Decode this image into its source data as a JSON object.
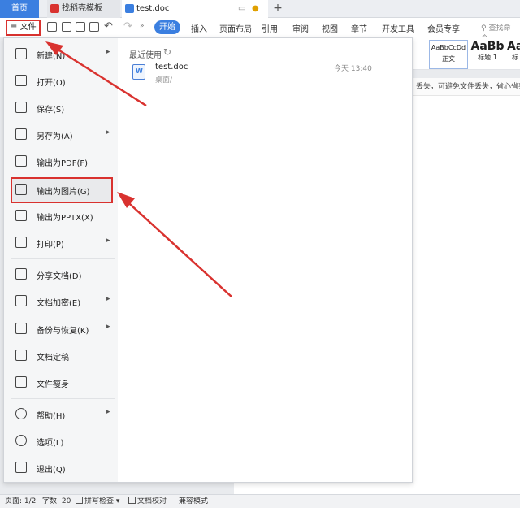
{
  "tabs": {
    "home": "首页",
    "template": "找稻壳模板",
    "doc": "test.doc"
  },
  "toolbar": {
    "file": "文件",
    "start": "开始",
    "items": [
      "插入",
      "页面布局",
      "引用",
      "审阅",
      "视图",
      "章节",
      "开发工具",
      "会员专享"
    ],
    "search": "查找命令、"
  },
  "styles": {
    "normal_sample": "AaBbCcDd",
    "normal_label": "正文",
    "h1_sample": "AaBb",
    "h1_label": "标题 1",
    "h2_sample": "Aa",
    "h2_label": "标"
  },
  "notice": "丢失，可避免文件丢失，省心省事",
  "menu": {
    "items": [
      {
        "label": "新建(N)",
        "icon": "new-file-icon",
        "arrow": "▸"
      },
      {
        "label": "打开(O)",
        "icon": "open-folder-icon",
        "arrow": ""
      },
      {
        "label": "保存(S)",
        "icon": "save-icon",
        "arrow": ""
      },
      {
        "label": "另存为(A)",
        "icon": "save-as-icon",
        "arrow": "▸"
      },
      {
        "label": "输出为PDF(F)",
        "icon": "pdf-icon",
        "arrow": ""
      },
      {
        "label": "输出为图片(G)",
        "icon": "image-icon",
        "arrow": ""
      },
      {
        "label": "输出为PPTX(X)",
        "icon": "pptx-icon",
        "arrow": ""
      },
      {
        "label": "打印(P)",
        "icon": "print-icon",
        "arrow": "▸"
      },
      {
        "label": "分享文档(D)",
        "icon": "share-icon",
        "arrow": ""
      },
      {
        "label": "文档加密(E)",
        "icon": "lock-icon",
        "arrow": "▸"
      },
      {
        "label": "备份与恢复(K)",
        "icon": "backup-icon",
        "arrow": "▸"
      },
      {
        "label": "文档定稿",
        "icon": "finalize-icon",
        "arrow": ""
      },
      {
        "label": "文件瘦身",
        "icon": "slim-icon",
        "arrow": ""
      },
      {
        "label": "帮助(H)",
        "icon": "help-icon",
        "arrow": "▸"
      },
      {
        "label": "选项(L)",
        "icon": "gear-icon",
        "arrow": ""
      },
      {
        "label": "退出(Q)",
        "icon": "exit-icon",
        "arrow": ""
      }
    ],
    "recent_title": "最近使用",
    "recent_file": {
      "name": "test.doc",
      "path": "桌面/",
      "time": "今天  13:40"
    }
  },
  "status": {
    "page": "页面: 1/2",
    "words": "字数: 20",
    "spell": "拼写检查",
    "proof": "文档校对",
    "compat": "兼容模式"
  },
  "colors": {
    "accent": "#3b7fe0",
    "annotation": "#d9322f"
  }
}
